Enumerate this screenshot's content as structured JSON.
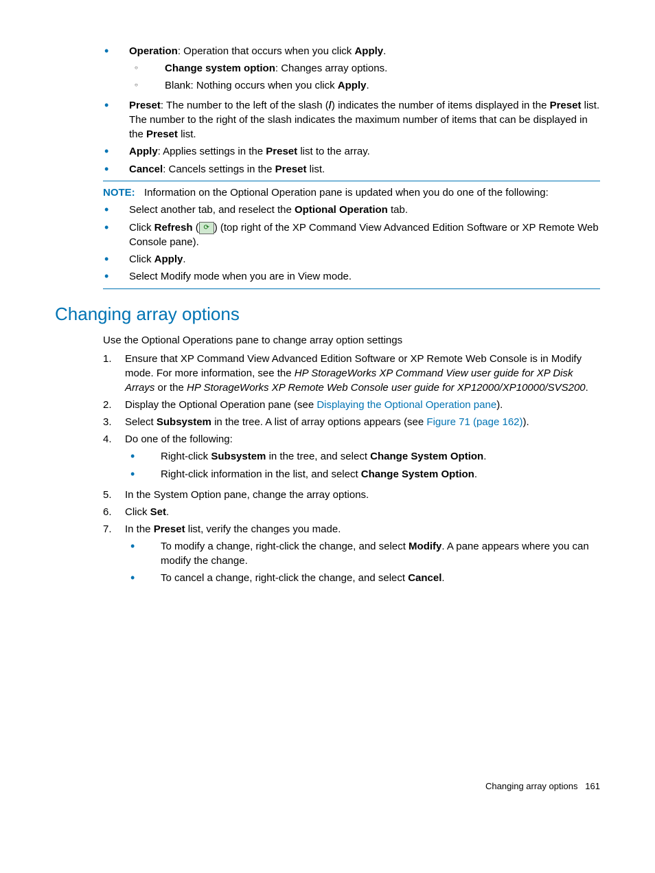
{
  "top_bullets": {
    "operation_bold": "Operation",
    "operation_rest": ": Operation that occurs when you click ",
    "operation_apply": "Apply",
    "operation_end": ".",
    "change_opt_bold": "Change system option",
    "change_opt_rest": ": Changes array options.",
    "blank_text": "Blank: Nothing occurs when you click ",
    "blank_apply": "Apply",
    "blank_end": ".",
    "preset_bold": "Preset",
    "preset_rest1": ": The number to the left of the slash (",
    "preset_slash": "/",
    "preset_rest2": ") indicates the number of items displayed in the ",
    "preset_bold2": "Preset",
    "preset_rest3": " list. The number to the right of the slash indicates the maximum number of items that can be displayed in the ",
    "preset_bold3": "Preset",
    "preset_rest4": " list.",
    "apply_bold": "Apply",
    "apply_rest1": ": Applies settings in the ",
    "apply_preset": "Preset",
    "apply_rest2": " list to the array.",
    "cancel_bold": "Cancel",
    "cancel_rest1": ": Cancels settings in the ",
    "cancel_preset": "Preset",
    "cancel_rest2": " list."
  },
  "note": {
    "label": "NOTE:",
    "text": "Information on the Optional Operation pane is updated when you do one of the following:"
  },
  "note_bullets": {
    "b1a": "Select another tab, and reselect the ",
    "b1b": "Optional Operation",
    "b1c": " tab.",
    "b2a": "Click ",
    "b2b": "Refresh",
    "b2c": " (",
    "b2d": ") (top right of the XP Command View Advanced Edition Software or XP Remote Web Console pane).",
    "b3a": "Click ",
    "b3b": "Apply",
    "b3c": ".",
    "b4": "Select Modify mode when you are in View mode."
  },
  "heading": "Changing array options",
  "intro": "Use the Optional Operations pane to change array option settings",
  "steps": {
    "s1a": "Ensure that XP Command View Advanced Edition Software or XP Remote Web Console is in Modify mode. For more information, see the ",
    "s1b": "HP StorageWorks XP Command View user guide for XP Disk Arrays",
    "s1c": " or the ",
    "s1d": "HP StorageWorks XP Remote Web Console user guide for XP12000/XP10000/SVS200",
    "s1e": ".",
    "s2a": "Display the Optional Operation pane (see ",
    "s2b": "Displaying the Optional Operation pane",
    "s2c": ").",
    "s3a": "Select ",
    "s3b": "Subsystem",
    "s3c": " in the tree. A list of array options appears (see ",
    "s3d": "Figure 71 (page 162)",
    "s3e": ").",
    "s4": "Do one of the following:",
    "s4_1a": "Right-click ",
    "s4_1b": "Subsystem",
    "s4_1c": " in the tree, and select ",
    "s4_1d": "Change System Option",
    "s4_1e": ".",
    "s4_2a": "Right-click information in the list, and select ",
    "s4_2b": "Change System Option",
    "s4_2c": ".",
    "s5": "In the System Option pane, change the array options.",
    "s6a": "Click ",
    "s6b": "Set",
    "s6c": ".",
    "s7a": "In the ",
    "s7b": "Preset",
    "s7c": " list, verify the changes you made.",
    "s7_1a": "To modify a change, right-click the change, and select ",
    "s7_1b": "Modify",
    "s7_1c": ". A pane appears where you can modify the change.",
    "s7_2a": "To cancel a change, right-click the change, and select ",
    "s7_2b": "Cancel",
    "s7_2c": "."
  },
  "footer": {
    "text": "Changing array options",
    "page": "161"
  },
  "nums": {
    "n1": "1.",
    "n2": "2.",
    "n3": "3.",
    "n4": "4.",
    "n5": "5.",
    "n6": "6.",
    "n7": "7."
  }
}
